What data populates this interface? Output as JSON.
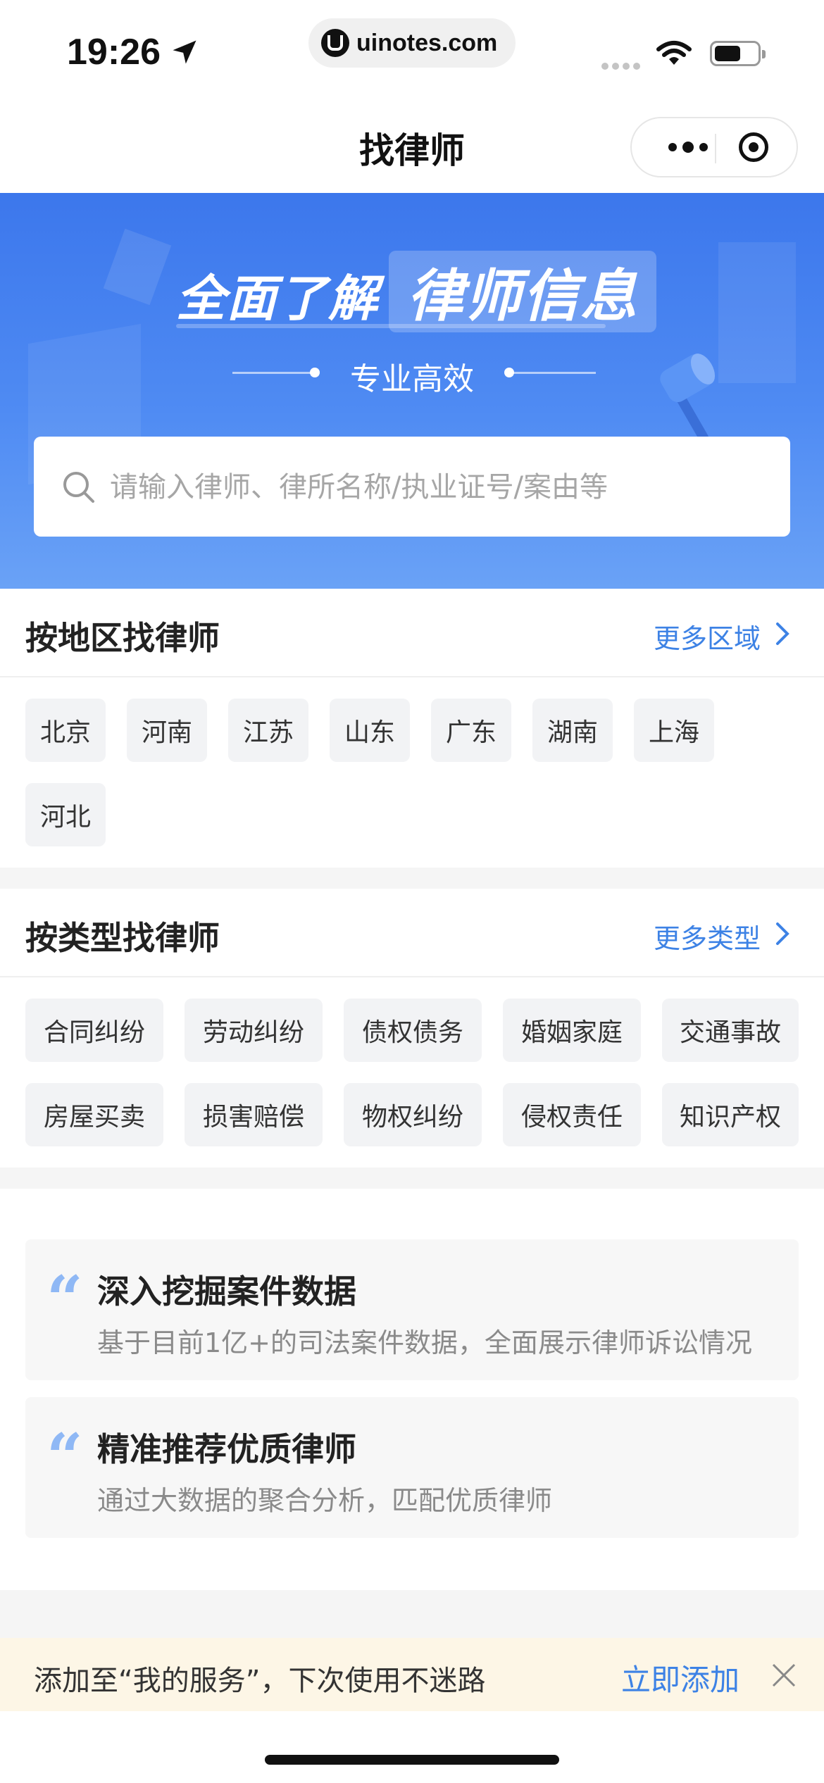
{
  "status_bar": {
    "time": "19:26",
    "url": "uinotes.com"
  },
  "nav": {
    "title": "找律师"
  },
  "banner": {
    "title_prefix": "全面了解",
    "title_highlight": "律师信息",
    "subtitle": "专业高效"
  },
  "search": {
    "placeholder": "请输入律师、律所名称/执业证号/案由等"
  },
  "region_section": {
    "title": "按地区找律师",
    "more_label": "更多区域",
    "items": [
      "北京",
      "河南",
      "江苏",
      "山东",
      "广东",
      "湖南",
      "上海",
      "河北"
    ]
  },
  "type_section": {
    "title": "按类型找律师",
    "more_label": "更多类型",
    "items": [
      "合同纠纷",
      "劳动纠纷",
      "债权债务",
      "婚姻家庭",
      "交通事故",
      "房屋买卖",
      "损害赔偿",
      "物权纠纷",
      "侵权责任",
      "知识产权"
    ]
  },
  "features": [
    {
      "title": "深入挖掘案件数据",
      "desc": "基于目前1亿+的司法案件数据，全面展示律师诉讼情况"
    },
    {
      "title": "精准推荐优质律师",
      "desc": "通过大数据的聚合分析，匹配优质律师"
    }
  ],
  "add_bar": {
    "text": "添加至“我的服务”，下次使用不迷路",
    "button": "立即添加"
  },
  "colors": {
    "primary": "#3d82e5",
    "banner": "#4a86f0",
    "chip_bg": "#f2f3f5",
    "add_bar_bg": "#fdf6e6"
  }
}
